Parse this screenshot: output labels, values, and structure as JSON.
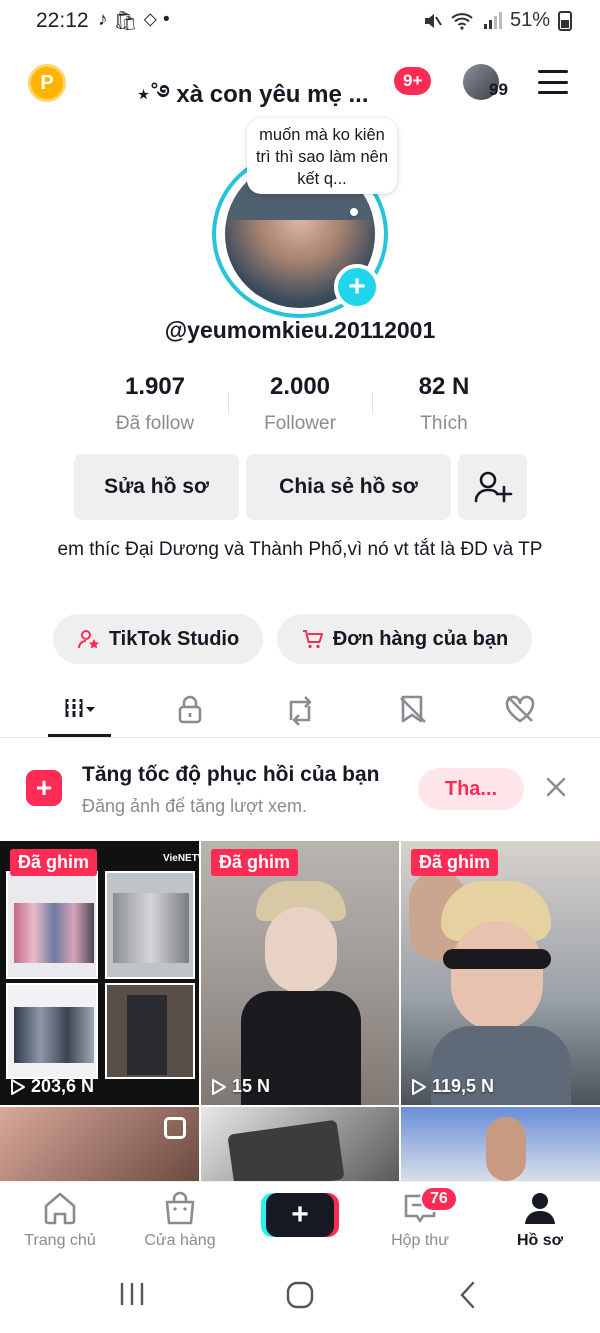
{
  "status_bar": {
    "time": "22:12",
    "app_icons": [
      "♪",
      "🛍",
      "⬦",
      "•"
    ],
    "battery": "51%"
  },
  "top_bar": {
    "coin_label": "P",
    "profile_name": "⋆˚࿔ xà con yêu mẹ ...",
    "notification_count": "9+",
    "friends_count": "99"
  },
  "profile": {
    "note": "muốn mà ko kiên trì thì sao làm nên kết q...",
    "username": "@yeumomkieu.20112001",
    "stats": [
      {
        "value": "1.907",
        "label": "Đã follow"
      },
      {
        "value": "2.000",
        "label": "Follower"
      },
      {
        "value": "82 N",
        "label": "Thích"
      }
    ],
    "edit_button": "Sửa hồ sơ",
    "share_button": "Chia sẻ hồ sơ",
    "bio": "em thíc Đại Dương và Thành Phố,vì nó vt tắt là ĐD và TP",
    "studio_label": "TikTok Studio",
    "orders_label": "Đơn hàng của bạn"
  },
  "tabs": [
    "videos-grid-icon",
    "lock-icon",
    "repost-icon",
    "favorites-icon",
    "liked-icon"
  ],
  "promo": {
    "title": "Tăng tốc độ phục hồi của bạn",
    "subtitle": "Đăng ảnh để tăng lượt xem.",
    "button": "Tha..."
  },
  "videos": [
    {
      "pinned": "Đã ghim",
      "views": "203,6 N",
      "watermark": "VieNETWORK"
    },
    {
      "pinned": "Đã ghim",
      "views": "15 N"
    },
    {
      "pinned": "Đã ghim",
      "views": "119,5 N"
    }
  ],
  "bottom_nav": {
    "home": "Trang chủ",
    "shop": "Cửa hàng",
    "inbox": "Hộp thư",
    "inbox_badge": "76",
    "profile": "Hồ sơ"
  },
  "colors": {
    "accent": "#fe2c55",
    "ring": "#25c4d9",
    "text": "#161823",
    "muted": "#8a8b91"
  }
}
